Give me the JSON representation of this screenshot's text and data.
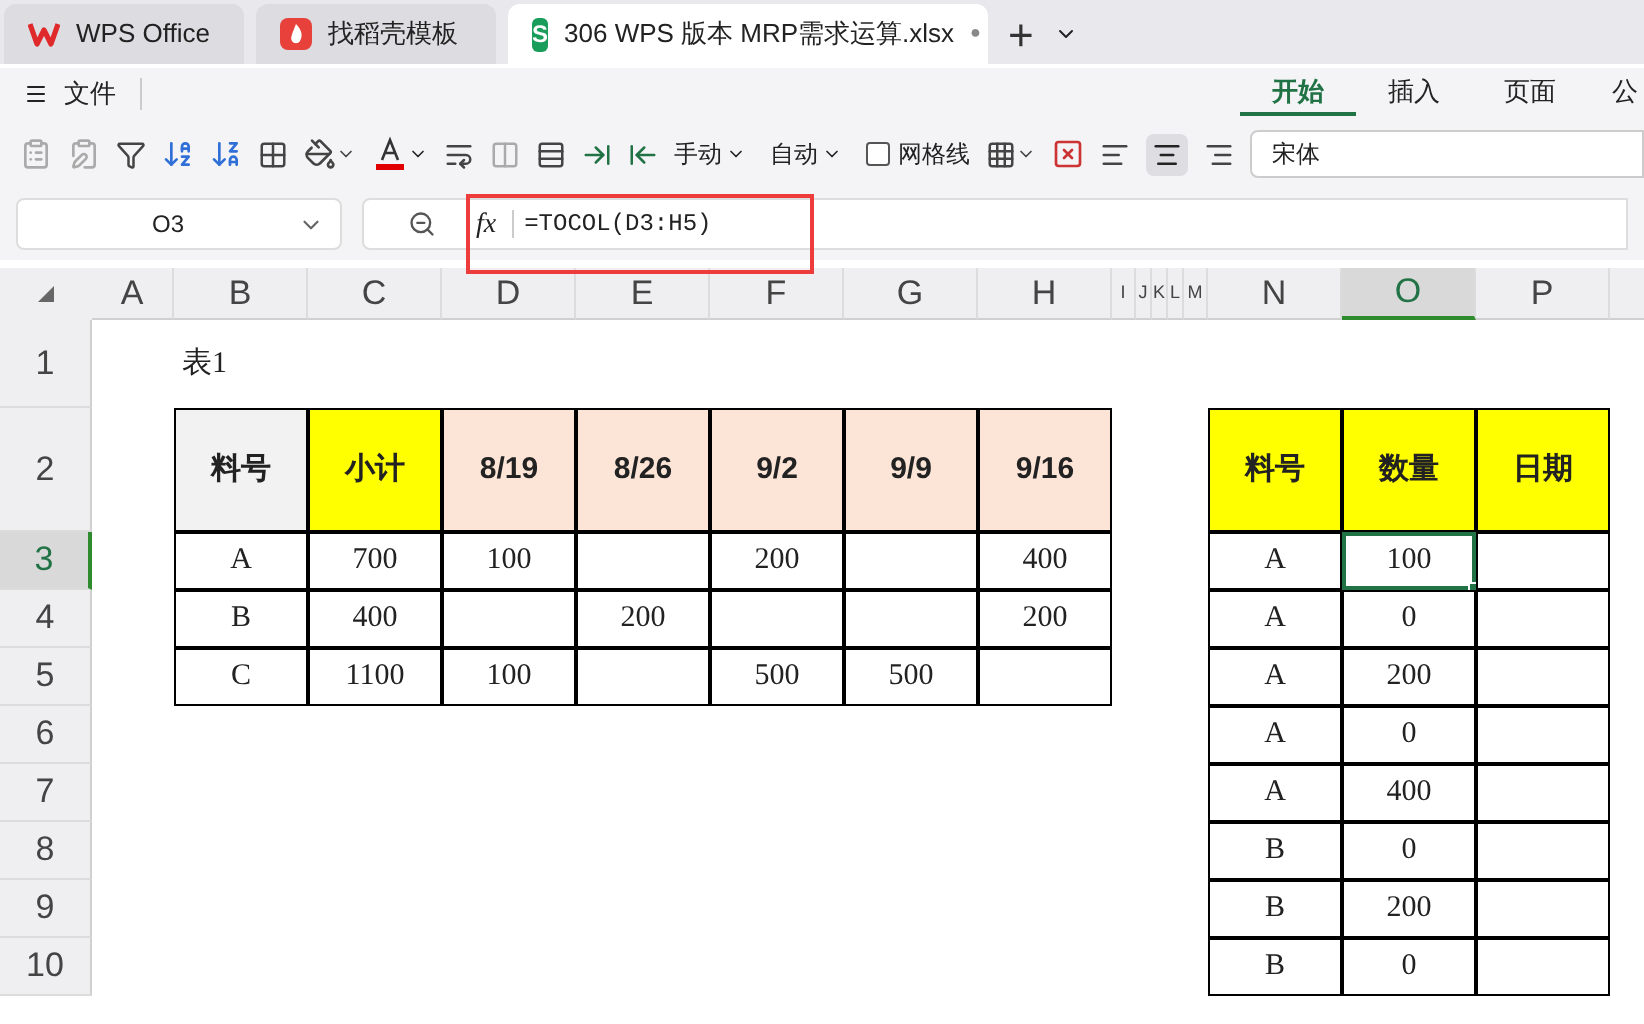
{
  "tabs": [
    {
      "kind": "wps",
      "label": "WPS Office",
      "selected": false
    },
    {
      "kind": "template",
      "label": "找稻壳模板",
      "selected": false
    },
    {
      "kind": "sheet",
      "badge": "S",
      "label": "306 WPS 版本 MRP需求运算.xlsx",
      "modified": "●",
      "selected": true
    }
  ],
  "new_tab": "+",
  "menu": {
    "file": "文件",
    "ribbon_tabs": [
      {
        "label": "开始",
        "selected": true
      },
      {
        "label": "插入",
        "selected": false
      },
      {
        "label": "页面",
        "selected": false
      },
      {
        "label": "公",
        "selected": false
      }
    ]
  },
  "toolbar": {
    "row_height": "手动",
    "col_width": "自动",
    "gridlines": {
      "label": "网格线",
      "checked": false
    },
    "font": "宋体"
  },
  "formula_bar": {
    "name_box": "O3",
    "fx": "fx",
    "formula": "=TOCOL(D3:H5)"
  },
  "columns": [
    {
      "label": "A",
      "selected": false
    },
    {
      "label": "B",
      "selected": false
    },
    {
      "label": "C",
      "selected": false
    },
    {
      "label": "D",
      "selected": false
    },
    {
      "label": "E",
      "selected": false
    },
    {
      "label": "F",
      "selected": false
    },
    {
      "label": "G",
      "selected": false
    },
    {
      "label": "H",
      "selected": false
    },
    {
      "label": "I",
      "selected": false
    },
    {
      "label": "J",
      "selected": false
    },
    {
      "label": "K",
      "selected": false
    },
    {
      "label": "L",
      "selected": false
    },
    {
      "label": "M",
      "selected": false
    },
    {
      "label": "N",
      "selected": false
    },
    {
      "label": "O",
      "selected": true
    },
    {
      "label": "P",
      "selected": false
    }
  ],
  "rows": [
    {
      "label": "1",
      "selected": false
    },
    {
      "label": "2",
      "selected": false
    },
    {
      "label": "3",
      "selected": true
    },
    {
      "label": "4",
      "selected": false
    },
    {
      "label": "5",
      "selected": false
    },
    {
      "label": "6",
      "selected": false
    },
    {
      "label": "7",
      "selected": false
    },
    {
      "label": "8",
      "selected": false
    },
    {
      "label": "9",
      "selected": false
    },
    {
      "label": "10",
      "selected": false
    }
  ],
  "caption": "表1",
  "table1": {
    "header": [
      {
        "text": "料号",
        "color": "#f2f2f2"
      },
      {
        "text": "小计",
        "color": "#ffff00"
      },
      {
        "text": "8/19",
        "color": "#fce4d6"
      },
      {
        "text": "8/26",
        "color": "#fce4d6"
      },
      {
        "text": "9/2",
        "color": "#fce4d6"
      },
      {
        "text": "9/9",
        "color": "#fce4d6"
      },
      {
        "text": "9/16",
        "color": "#fce4d6"
      }
    ],
    "rows": [
      [
        "A",
        "700",
        "100",
        "",
        "200",
        "",
        "400"
      ],
      [
        "B",
        "400",
        "",
        "200",
        "",
        "",
        "200"
      ],
      [
        "C",
        "1100",
        "100",
        "",
        "500",
        "500",
        ""
      ]
    ]
  },
  "table2": {
    "header": [
      {
        "text": "料号",
        "color": "#ffff00"
      },
      {
        "text": "数量",
        "color": "#ffff00"
      },
      {
        "text": "日期",
        "color": "#ffff00"
      }
    ],
    "rows": [
      {
        "cells": [
          "A",
          "100",
          ""
        ],
        "selected": [
          false,
          true,
          false
        ]
      },
      {
        "cells": [
          "A",
          "0",
          ""
        ],
        "selected": [
          false,
          false,
          false
        ]
      },
      {
        "cells": [
          "A",
          "200",
          ""
        ],
        "selected": [
          false,
          false,
          false
        ]
      },
      {
        "cells": [
          "A",
          "0",
          ""
        ],
        "selected": [
          false,
          false,
          false
        ]
      },
      {
        "cells": [
          "A",
          "400",
          ""
        ],
        "selected": [
          false,
          false,
          false
        ]
      },
      {
        "cells": [
          "B",
          "0",
          ""
        ],
        "selected": [
          false,
          false,
          false
        ]
      },
      {
        "cells": [
          "B",
          "200",
          ""
        ],
        "selected": [
          false,
          false,
          false
        ]
      },
      {
        "cells": [
          "B",
          "0",
          ""
        ],
        "selected": [
          false,
          false,
          false
        ]
      }
    ]
  }
}
